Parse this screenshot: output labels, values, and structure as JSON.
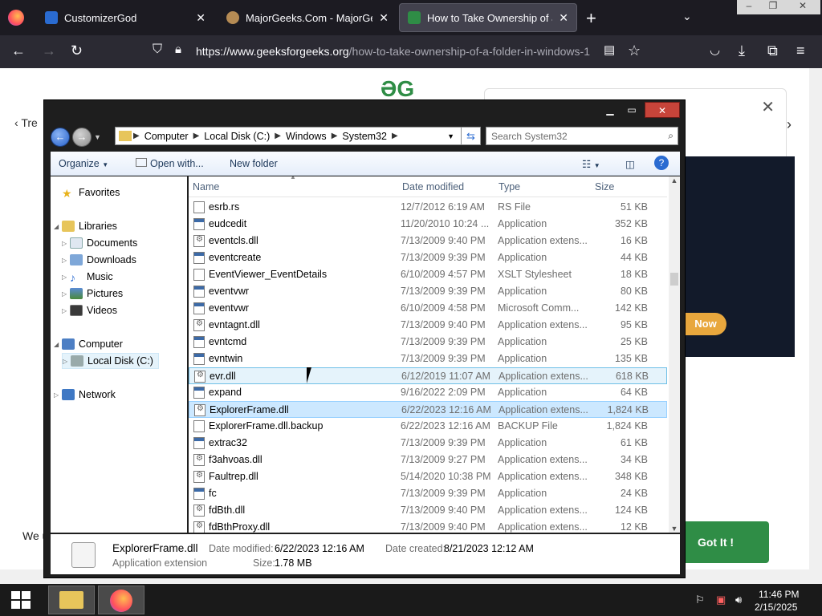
{
  "browser": {
    "tabs": [
      {
        "title": "CustomizerGod",
        "close": "✕"
      },
      {
        "title": "MajorGeeks.Com - MajorGeeks",
        "close": "✕"
      },
      {
        "title": "How to Take Ownership of a Fo",
        "close": "✕"
      }
    ],
    "new_tab": "+",
    "url_domain": "https://www.geeksforgeeks.org",
    "url_path": "/how-to-take-ownership-of-a-folder-in-windows-1"
  },
  "webpage": {
    "logo": "ƏG",
    "treb": "Tre",
    "now_button": "Now",
    "cookie_text": "We u",
    "gotit_button": "Got It !"
  },
  "explorer": {
    "breadcrumb": [
      "Computer",
      "Local Disk (C:)",
      "Windows",
      "System32"
    ],
    "search_placeholder": "Search System32",
    "toolbar": {
      "organize": "Organize",
      "open_with": "Open with...",
      "new_folder": "New folder"
    },
    "nav": {
      "favorites": "Favorites",
      "libraries": "Libraries",
      "documents": "Documents",
      "downloads": "Downloads",
      "music": "Music",
      "pictures": "Pictures",
      "videos": "Videos",
      "computer": "Computer",
      "local_disk": "Local Disk (C:)",
      "network": "Network"
    },
    "columns": {
      "name": "Name",
      "date": "Date modified",
      "type": "Type",
      "size": "Size"
    },
    "files": [
      {
        "name": "esrb.rs",
        "date": "12/7/2012 6:19 AM",
        "type": "RS File",
        "size": "51 KB",
        "icon": "file-icon"
      },
      {
        "name": "eudcedit",
        "date": "11/20/2010 10:24 ...",
        "type": "Application",
        "size": "352 KB",
        "icon": "app-icon"
      },
      {
        "name": "eventcls.dll",
        "date": "7/13/2009 9:40 PM",
        "type": "Application extens...",
        "size": "16 KB",
        "icon": "dll-icon"
      },
      {
        "name": "eventcreate",
        "date": "7/13/2009 9:39 PM",
        "type": "Application",
        "size": "44 KB",
        "icon": "app-icon"
      },
      {
        "name": "EventViewer_EventDetails",
        "date": "6/10/2009 4:57 PM",
        "type": "XSLT Stylesheet",
        "size": "18 KB",
        "icon": "file-icon"
      },
      {
        "name": "eventvwr",
        "date": "7/13/2009 9:39 PM",
        "type": "Application",
        "size": "80 KB",
        "icon": "app-icon"
      },
      {
        "name": "eventvwr",
        "date": "6/10/2009 4:58 PM",
        "type": "Microsoft Comm...",
        "size": "142 KB",
        "icon": "app-icon"
      },
      {
        "name": "evntagnt.dll",
        "date": "7/13/2009 9:40 PM",
        "type": "Application extens...",
        "size": "95 KB",
        "icon": "dll-icon"
      },
      {
        "name": "evntcmd",
        "date": "7/13/2009 9:39 PM",
        "type": "Application",
        "size": "25 KB",
        "icon": "app-icon"
      },
      {
        "name": "evntwin",
        "date": "7/13/2009 9:39 PM",
        "type": "Application",
        "size": "135 KB",
        "icon": "app-icon"
      },
      {
        "name": "evr.dll",
        "date": "6/12/2019 11:07 AM",
        "type": "Application extens...",
        "size": "618 KB",
        "icon": "dll-icon"
      },
      {
        "name": "expand",
        "date": "9/16/2022 2:09 PM",
        "type": "Application",
        "size": "64 KB",
        "icon": "app-icon"
      },
      {
        "name": "ExplorerFrame.dll",
        "date": "6/22/2023 12:16 AM",
        "type": "Application extens...",
        "size": "1,824 KB",
        "icon": "dll-icon"
      },
      {
        "name": "ExplorerFrame.dll.backup",
        "date": "6/22/2023 12:16 AM",
        "type": "BACKUP File",
        "size": "1,824 KB",
        "icon": "file-icon"
      },
      {
        "name": "extrac32",
        "date": "7/13/2009 9:39 PM",
        "type": "Application",
        "size": "61 KB",
        "icon": "app-icon"
      },
      {
        "name": "f3ahvoas.dll",
        "date": "7/13/2009 9:27 PM",
        "type": "Application extens...",
        "size": "34 KB",
        "icon": "dll-icon"
      },
      {
        "name": "Faultrep.dll",
        "date": "5/14/2020 10:38 PM",
        "type": "Application extens...",
        "size": "348 KB",
        "icon": "dll-icon"
      },
      {
        "name": "fc",
        "date": "7/13/2009 9:39 PM",
        "type": "Application",
        "size": "24 KB",
        "icon": "app-icon"
      },
      {
        "name": "fdBth.dll",
        "date": "7/13/2009 9:40 PM",
        "type": "Application extens...",
        "size": "124 KB",
        "icon": "dll-icon"
      },
      {
        "name": "fdBthProxy.dll",
        "date": "7/13/2009 9:40 PM",
        "type": "Application extens...",
        "size": "12 KB",
        "icon": "dll-icon"
      }
    ],
    "hover_index": 10,
    "selected_index": 12,
    "details": {
      "name": "ExplorerFrame.dll",
      "kind": "Application extension",
      "date_modified_label": "Date modified:",
      "date_modified": "6/22/2023 12:16 AM",
      "date_created_label": "Date created:",
      "date_created": "8/21/2023 12:12 AM",
      "size_label": "Size:",
      "size": "1.78 MB"
    }
  },
  "taskbar": {
    "time": "11:46 PM",
    "date": "2/15/2025"
  }
}
